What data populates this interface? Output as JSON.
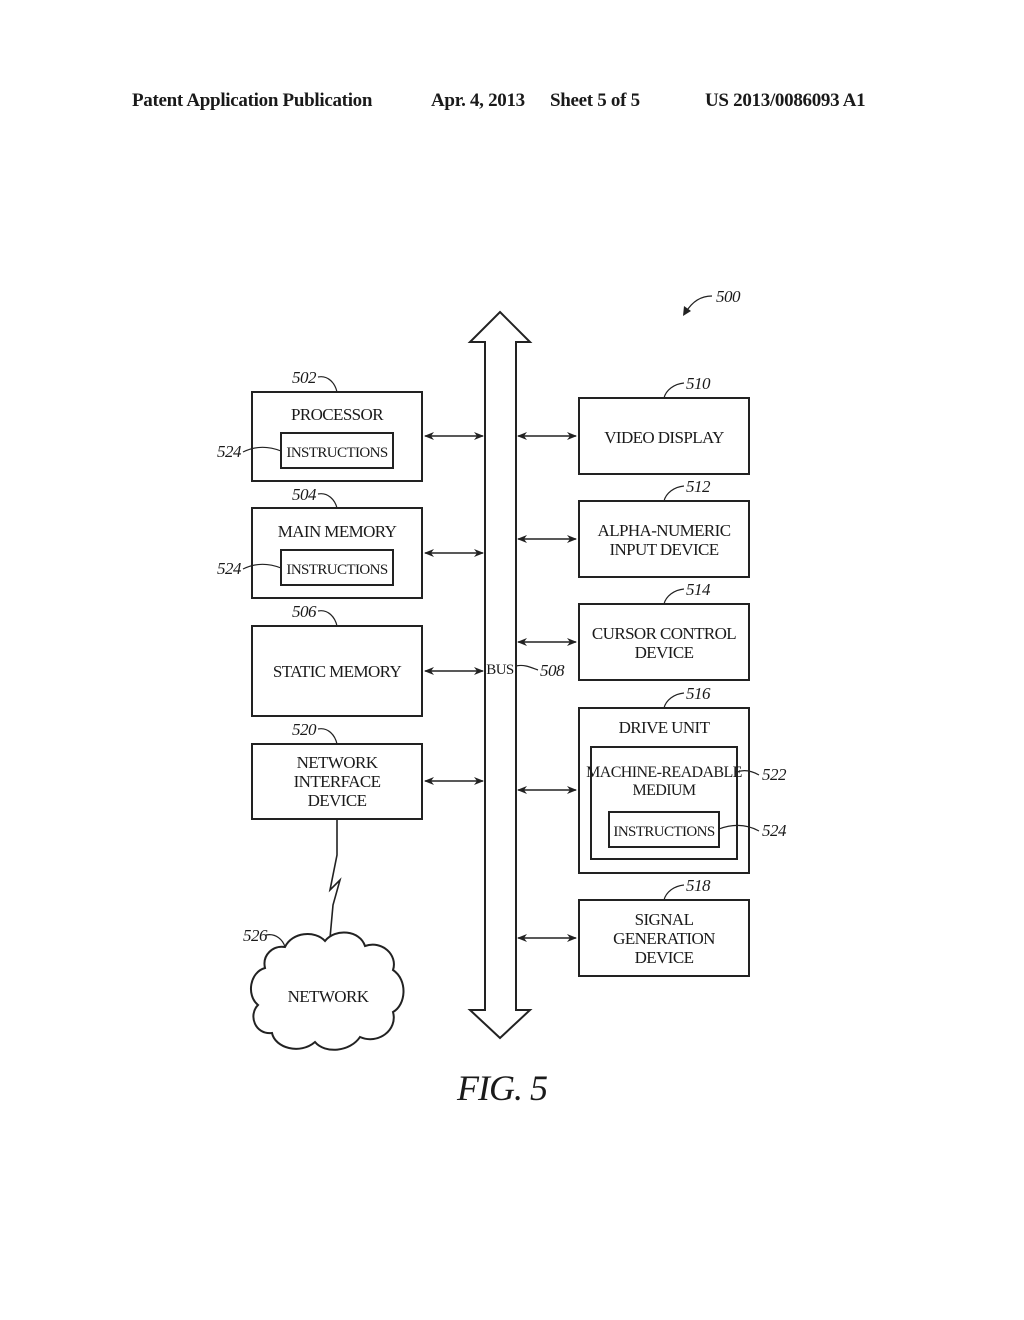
{
  "header": {
    "publication": "Patent Application Publication",
    "date": "Apr. 4, 2013",
    "sheet": "Sheet 5 of 5",
    "number": "US 2013/0086093 A1"
  },
  "figure": {
    "label": "FIG. 5",
    "ref": "500",
    "bus": {
      "label": "BUS",
      "ref": "508"
    },
    "left_blocks": [
      {
        "ref": "502",
        "lines": [
          "PROCESSOR"
        ],
        "inner": {
          "label": "INSTRUCTIONS",
          "ref": "524"
        }
      },
      {
        "ref": "504",
        "lines": [
          "MAIN MEMORY"
        ],
        "inner": {
          "label": "INSTRUCTIONS",
          "ref": "524"
        }
      },
      {
        "ref": "506",
        "lines": [
          "STATIC MEMORY"
        ]
      },
      {
        "ref": "520",
        "lines": [
          "NETWORK",
          "INTERFACE",
          "DEVICE"
        ]
      }
    ],
    "right_blocks": [
      {
        "ref": "510",
        "lines": [
          "VIDEO DISPLAY"
        ]
      },
      {
        "ref": "512",
        "lines": [
          "ALPHA-NUMERIC",
          "INPUT DEVICE"
        ]
      },
      {
        "ref": "514",
        "lines": [
          "CURSOR CONTROL",
          "DEVICE"
        ]
      },
      {
        "ref": "516",
        "lines": [
          "DRIVE UNIT"
        ],
        "medium": {
          "lines": [
            "MACHINE-READABLE",
            "MEDIUM"
          ],
          "ref": "522"
        },
        "inner": {
          "label": "INSTRUCTIONS",
          "ref": "524"
        }
      },
      {
        "ref": "518",
        "lines": [
          "SIGNAL",
          "GENERATION",
          "DEVICE"
        ]
      }
    ],
    "network": {
      "label": "NETWORK",
      "ref": "526"
    }
  }
}
